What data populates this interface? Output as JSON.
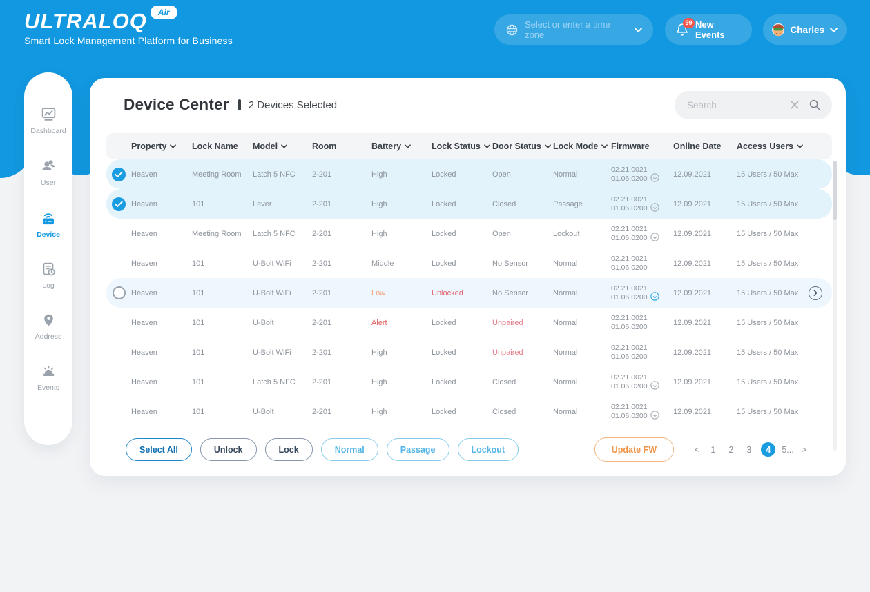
{
  "colors": {
    "brand_blue": "#1298e0",
    "selected_row_bg": "#e2f3fc",
    "hover_row_bg": "#eef7fd",
    "battery_low": "#f5a079",
    "battery_alert": "#e25c5c",
    "status_unlocked": "#e2626f",
    "status_unpaired": "#e27e8b",
    "fw_icon_gray": "#a9aeb5",
    "fw_icon_blue": "#2ba6e6",
    "active_page_bg": "#1a9ce1"
  },
  "header": {
    "logo_text": "ULTRALOQ",
    "logo_badge": "Air",
    "tagline": "Smart Lock Management Platform for Business",
    "timezone_placeholder": "Select or enter a time zone",
    "new_events_label": "New Events",
    "new_events_badge": "99",
    "user_name": "Charles"
  },
  "sidebar": {
    "items": [
      {
        "label": "Dashboard",
        "icon": "dashboard",
        "active": false
      },
      {
        "label": "User",
        "icon": "user",
        "active": false
      },
      {
        "label": "Device",
        "icon": "device",
        "active": true
      },
      {
        "label": "Log",
        "icon": "log",
        "active": false
      },
      {
        "label": "Address",
        "icon": "address",
        "active": false
      },
      {
        "label": "Events",
        "icon": "events",
        "active": false
      }
    ]
  },
  "main": {
    "title": "Device Center",
    "selection_status": "2 Devices Selected",
    "search_placeholder": "Search",
    "columns": [
      {
        "label": "Property",
        "sortable": true
      },
      {
        "label": "Lock Name",
        "sortable": false
      },
      {
        "label": "Model",
        "sortable": true
      },
      {
        "label": "Room",
        "sortable": false
      },
      {
        "label": "Battery",
        "sortable": true
      },
      {
        "label": "Lock Status",
        "sortable": true
      },
      {
        "label": "Door Status",
        "sortable": true
      },
      {
        "label": "Lock Mode",
        "sortable": true
      },
      {
        "label": "Firmware",
        "sortable": false
      },
      {
        "label": "Online Date",
        "sortable": false
      },
      {
        "label": "Access Users",
        "sortable": true
      }
    ],
    "rows": [
      {
        "check": "checked",
        "highlight": "selected",
        "property": "Heaven",
        "lock_name": "Meeting Room",
        "model": "Latch 5 NFC",
        "room": "2-201",
        "battery": "High",
        "battery_state": "normal",
        "lock_status": "Locked",
        "lock_state": "normal",
        "door_status": "Open",
        "door_state": "normal",
        "lock_mode": "Normal",
        "firmware": [
          "02.21.0021",
          "01.06.0200"
        ],
        "fw_icon": "gray",
        "online_date": "12.09.2021",
        "access_users": "15 Users / 50 Max",
        "chevron": false
      },
      {
        "check": "checked",
        "highlight": "selected",
        "property": "Heaven",
        "lock_name": "101",
        "model": "Lever",
        "room": "2-201",
        "battery": "High",
        "battery_state": "normal",
        "lock_status": "Locked",
        "lock_state": "normal",
        "door_status": "Closed",
        "door_state": "normal",
        "lock_mode": "Passage",
        "firmware": [
          "02.21.0021",
          "01.06.0200"
        ],
        "fw_icon": "gray",
        "online_date": "12.09.2021",
        "access_users": "15 Users / 50 Max",
        "chevron": false
      },
      {
        "check": "none",
        "highlight": "none",
        "property": "Heaven",
        "lock_name": "Meeting Room",
        "model": "Latch 5 NFC",
        "room": "2-201",
        "battery": "High",
        "battery_state": "normal",
        "lock_status": "Locked",
        "lock_state": "normal",
        "door_status": "Open",
        "door_state": "normal",
        "lock_mode": "Lockout",
        "firmware": [
          "02.21.0021",
          "01.06.0200"
        ],
        "fw_icon": "gray",
        "online_date": "12.09.2021",
        "access_users": "15 Users / 50 Max",
        "chevron": false
      },
      {
        "check": "none",
        "highlight": "none",
        "property": "Heaven",
        "lock_name": "101",
        "model": "U-Bolt WiFi",
        "room": "2-201",
        "battery": "Middle",
        "battery_state": "normal",
        "lock_status": "Locked",
        "lock_state": "normal",
        "door_status": "No Sensor",
        "door_state": "normal",
        "lock_mode": "Normal",
        "firmware": [
          "02.21.0021",
          "01.06.0200"
        ],
        "fw_icon": "none",
        "online_date": "12.09.2021",
        "access_users": "15 Users / 50 Max",
        "chevron": false
      },
      {
        "check": "circle",
        "highlight": "hover",
        "property": "Heaven",
        "lock_name": "101",
        "model": "U-Bolt WiFi",
        "room": "2-201",
        "battery": "Low",
        "battery_state": "low",
        "lock_status": "Unlocked",
        "lock_state": "unlocked",
        "door_status": "No Sensor",
        "door_state": "normal",
        "lock_mode": "Normal",
        "firmware": [
          "02.21.0021",
          "01.06.0200"
        ],
        "fw_icon": "blue",
        "online_date": "12.09.2021",
        "access_users": "15 Users / 50 Max",
        "chevron": true
      },
      {
        "check": "none",
        "highlight": "none",
        "property": "Heaven",
        "lock_name": "101",
        "model": "U-Bolt",
        "room": "2-201",
        "battery": "Alert",
        "battery_state": "alert",
        "lock_status": "Locked",
        "lock_state": "normal",
        "door_status": "Unpaired",
        "door_state": "unpaired",
        "lock_mode": "Normal",
        "firmware": [
          "02.21.0021",
          "01.06.0200"
        ],
        "fw_icon": "none",
        "online_date": "12.09.2021",
        "access_users": "15 Users / 50 Max",
        "chevron": false
      },
      {
        "check": "none",
        "highlight": "none",
        "property": "Heaven",
        "lock_name": "101",
        "model": "U-Bolt WiFi",
        "room": "2-201",
        "battery": "High",
        "battery_state": "normal",
        "lock_status": "Locked",
        "lock_state": "normal",
        "door_status": "Unpaired",
        "door_state": "unpaired",
        "lock_mode": "Normal",
        "firmware": [
          "02.21.0021",
          "01.06.0200"
        ],
        "fw_icon": "none",
        "online_date": "12.09.2021",
        "access_users": "15 Users / 50 Max",
        "chevron": false
      },
      {
        "check": "none",
        "highlight": "none",
        "property": "Heaven",
        "lock_name": "101",
        "model": "Latch 5 NFC",
        "room": "2-201",
        "battery": "High",
        "battery_state": "normal",
        "lock_status": "Locked",
        "lock_state": "normal",
        "door_status": "Closed",
        "door_state": "normal",
        "lock_mode": "Normal",
        "firmware": [
          "02.21.0021",
          "01.06.0200"
        ],
        "fw_icon": "gray",
        "online_date": "12.09.2021",
        "access_users": "15 Users / 50 Max",
        "chevron": false
      },
      {
        "check": "none",
        "highlight": "none",
        "property": "Heaven",
        "lock_name": "101",
        "model": "U-Bolt",
        "room": "2-201",
        "battery": "High",
        "battery_state": "normal",
        "lock_status": "Locked",
        "lock_state": "normal",
        "door_status": "Closed",
        "door_state": "normal",
        "lock_mode": "Normal",
        "firmware": [
          "02.21.0021",
          "01.06.0200"
        ],
        "fw_icon": "gray",
        "online_date": "12.09.2021",
        "access_users": "15 Users / 50 Max",
        "chevron": false
      }
    ]
  },
  "footer": {
    "actions": [
      {
        "label": "Select All",
        "variant": "primary"
      },
      {
        "label": "Unlock",
        "variant": "neutral"
      },
      {
        "label": "Lock",
        "variant": "neutral"
      },
      {
        "label": "Normal",
        "variant": "mode"
      },
      {
        "label": "Passage",
        "variant": "mode"
      },
      {
        "label": "Lockout",
        "variant": "mode"
      }
    ],
    "update_fw_label": "Update FW",
    "pagination": {
      "prev": "<",
      "pages": [
        "1",
        "2",
        "3",
        "4",
        "5..."
      ],
      "active": "4",
      "next": ">"
    }
  }
}
